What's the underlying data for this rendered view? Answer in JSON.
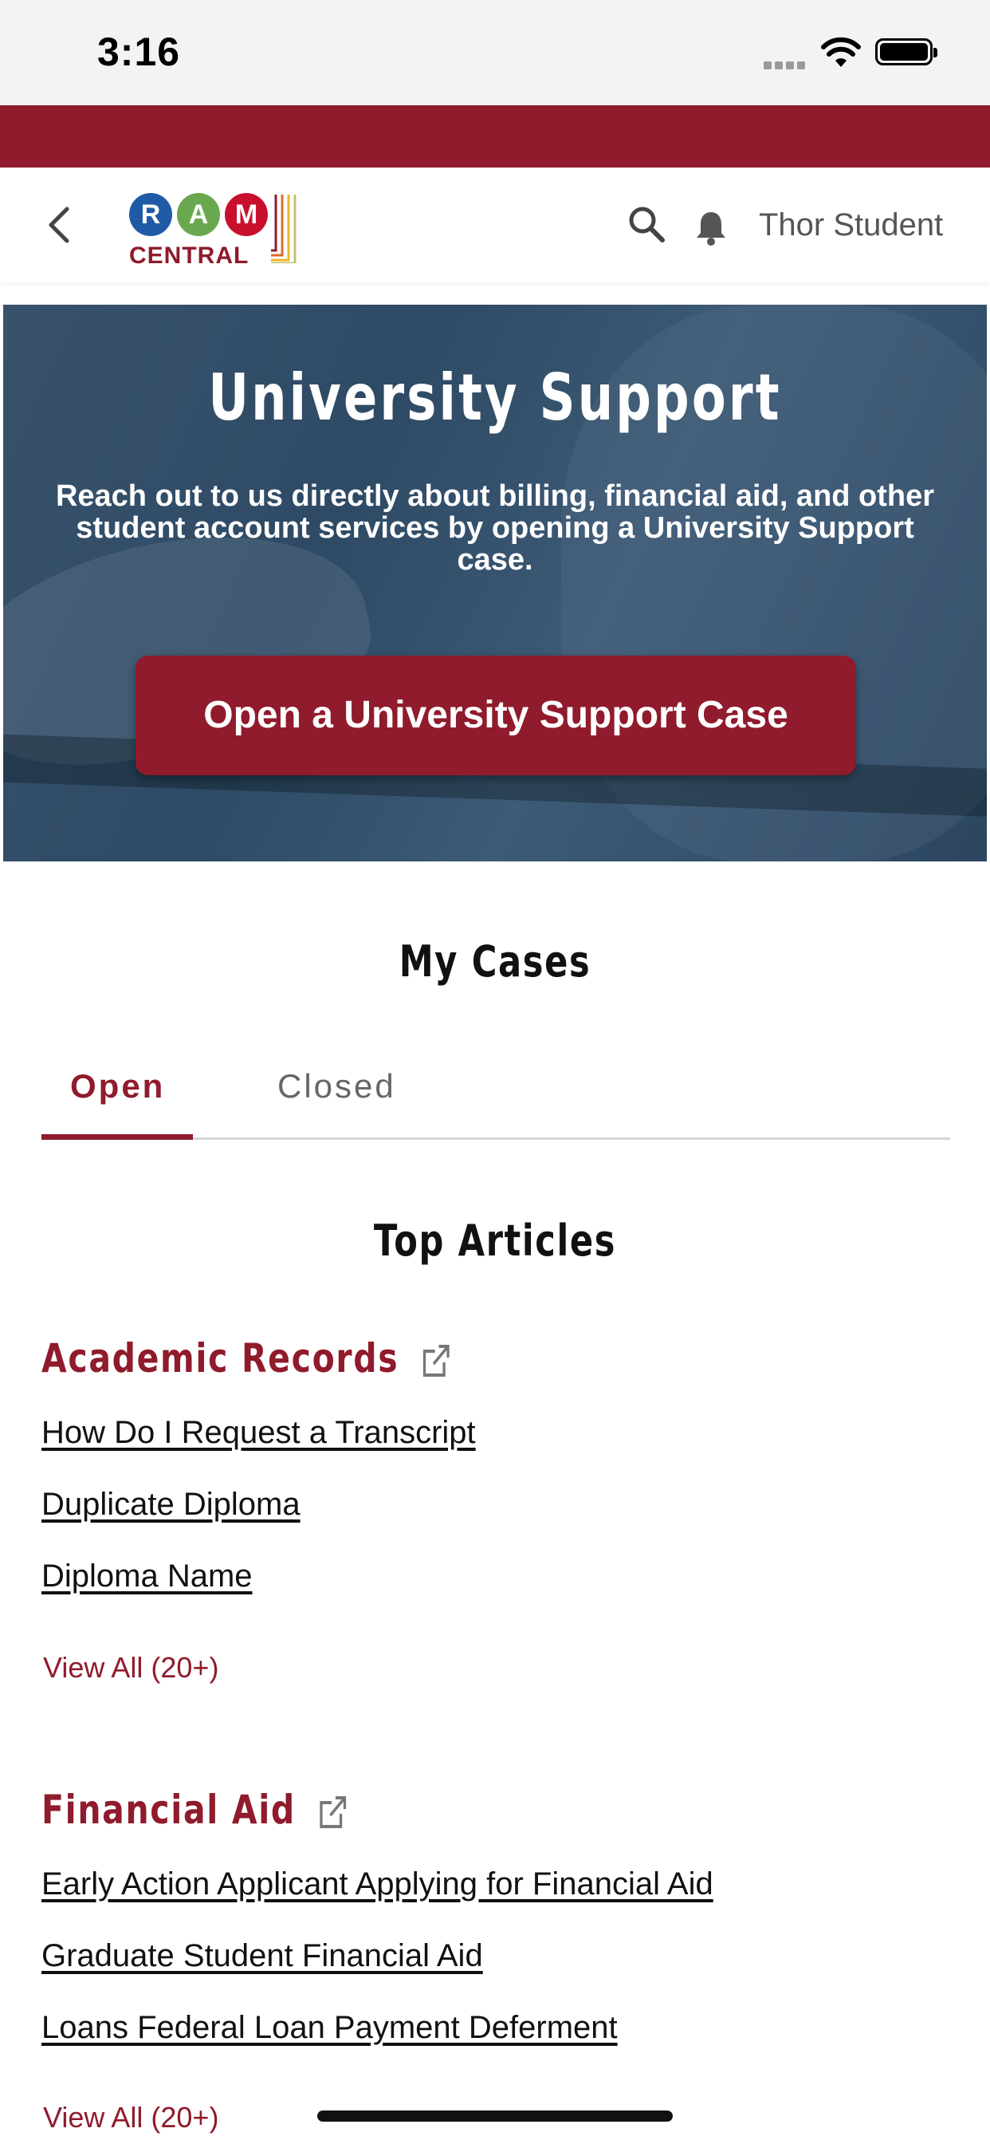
{
  "status": {
    "time": "3:16"
  },
  "header": {
    "logo": {
      "letters": [
        "R",
        "A",
        "M"
      ],
      "sub": "CENTRAL",
      "colors": [
        "#1f5aa6",
        "#6aa84f",
        "#c8102e"
      ]
    },
    "user_name": "Thor Student"
  },
  "hero": {
    "title": "University Support",
    "text": "Reach out to us directly about billing, financial aid, and other student account services by opening a University Support case.",
    "button_label": "Open a University Support Case"
  },
  "cases": {
    "title": "My Cases",
    "tabs": [
      {
        "label": "Open",
        "active": true
      },
      {
        "label": "Closed",
        "active": false
      }
    ]
  },
  "top_articles": {
    "title": "Top Articles",
    "categories": [
      {
        "name": "Academic Records",
        "articles": [
          "How Do I Request a Transcript",
          "Duplicate Diploma",
          "Diploma Name"
        ],
        "view_all": "View All (20+)"
      },
      {
        "name": "Financial Aid",
        "articles": [
          "Early Action Applicant Applying for Financial Aid",
          "Graduate Student Financial Aid",
          "Loans Federal Loan Payment Deferment"
        ],
        "view_all": "View All (20+)"
      }
    ]
  },
  "colors": {
    "accent": "#8f1b2c",
    "hero_bg": "#2e4a64"
  },
  "icons": [
    "back-chevron-icon",
    "search-icon",
    "bell-icon",
    "external-link-icon",
    "wifi-icon",
    "battery-icon"
  ]
}
